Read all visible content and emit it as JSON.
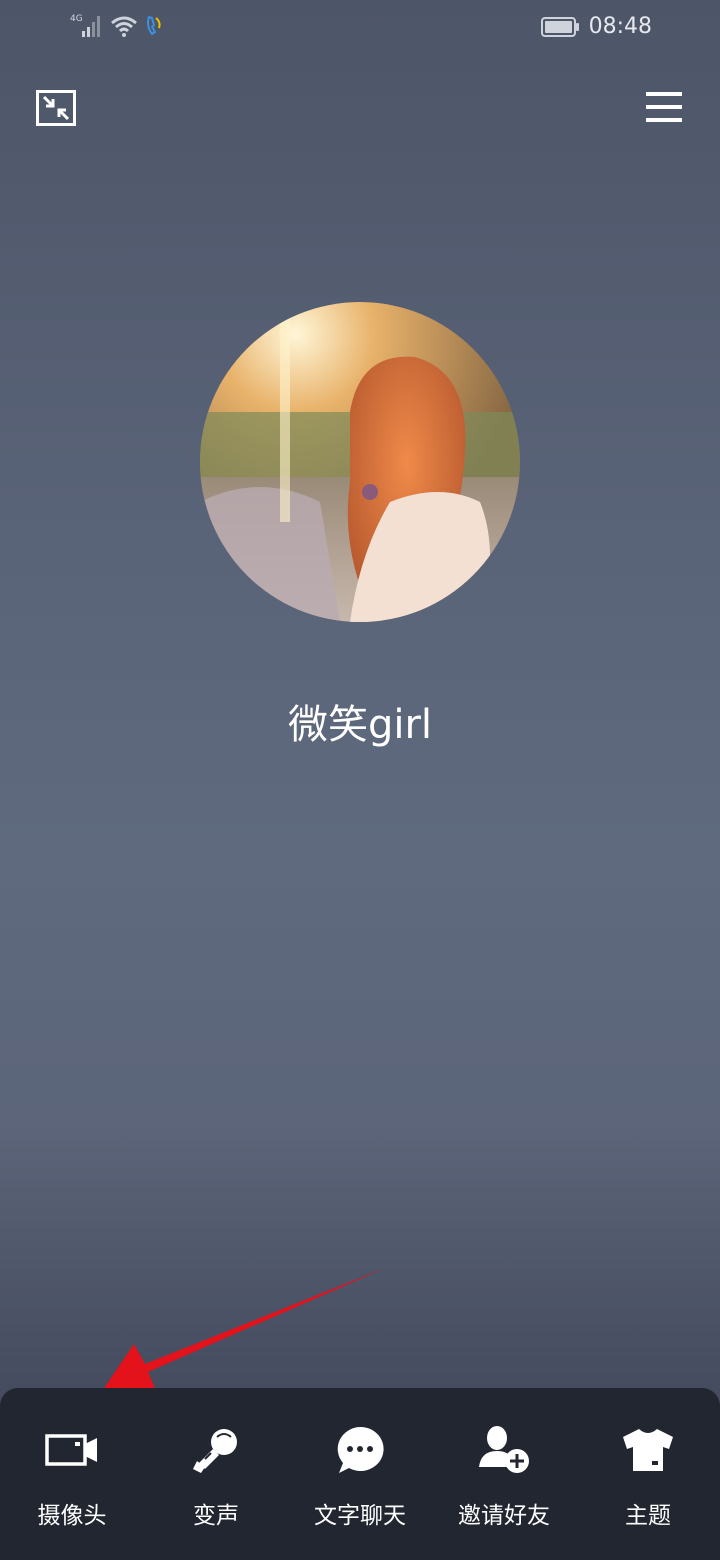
{
  "status_bar": {
    "network_label": "4G",
    "time": "08:48",
    "icons": [
      "signal-icon",
      "wifi-icon",
      "call-icon",
      "battery-icon"
    ]
  },
  "header": {
    "minimize_icon": "minimize-window-icon",
    "menu_icon": "hamburger-menu-icon"
  },
  "contact": {
    "name": "微笑girl",
    "avatar": "avatar-photo"
  },
  "actions": [
    {
      "label": "摄像头",
      "icon": "camera-icon"
    },
    {
      "label": "变声",
      "icon": "voice-changer-icon"
    },
    {
      "label": "文字聊天",
      "icon": "chat-bubble-icon"
    },
    {
      "label": "邀请好友",
      "icon": "add-friend-icon"
    },
    {
      "label": "主题",
      "icon": "theme-shirt-icon"
    }
  ],
  "colors": {
    "panel_bg": "#222630",
    "annotation_arrow": "#e3121b"
  }
}
